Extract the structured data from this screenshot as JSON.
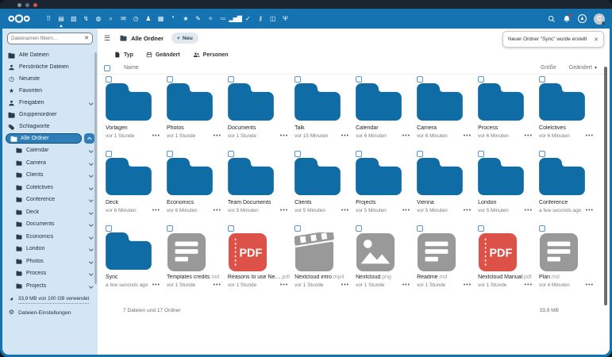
{
  "window": {
    "title_dots": [
      "gray",
      "slate",
      "red"
    ]
  },
  "topbar": {
    "logo_name": "nextcloud-logo",
    "apps": [
      {
        "name": "dashboard",
        "glyph": "⠿"
      },
      {
        "name": "files",
        "glyph": "▤",
        "active": true
      },
      {
        "name": "photos",
        "glyph": "▧"
      },
      {
        "name": "activity",
        "glyph": "↯"
      },
      {
        "name": "talk",
        "glyph": "◍"
      },
      {
        "name": "search-app",
        "glyph": "⌕"
      },
      {
        "name": "mail",
        "glyph": "✉"
      },
      {
        "name": "recent",
        "glyph": "◷"
      },
      {
        "name": "contacts",
        "glyph": "♟"
      },
      {
        "name": "calendar",
        "glyph": "▦"
      },
      {
        "name": "collectives",
        "glyph": "❜"
      },
      {
        "name": "favorites",
        "glyph": "★"
      },
      {
        "name": "notes",
        "glyph": "✎"
      },
      {
        "name": "recommendations",
        "glyph": "✧"
      },
      {
        "name": "tasks",
        "glyph": "≔"
      },
      {
        "name": "analytics",
        "glyph": "▂▅▇"
      },
      {
        "name": "approvals",
        "glyph": "✓"
      },
      {
        "name": "passwords",
        "glyph": "⚷"
      },
      {
        "name": "deck",
        "glyph": "◫"
      },
      {
        "name": "cookbook",
        "glyph": "Ψ"
      }
    ],
    "avatar_letter": "C"
  },
  "sidebar": {
    "filter": {
      "placeholder": "Dateinamen filtern...",
      "clear": "✕"
    },
    "items": [
      {
        "label": "Alle Dateien"
      },
      {
        "label": "Persönliche Dateien"
      },
      {
        "label": "Neueste"
      },
      {
        "label": "Favoriten"
      },
      {
        "label": "Freigaben"
      },
      {
        "label": "Gruppenordner"
      },
      {
        "label": "Schlagworte"
      }
    ],
    "selected_item": "Alle Ordner",
    "tree": [
      "Calendar",
      "Camera",
      "Clients",
      "Colelctives",
      "Conference",
      "Deck",
      "Documents",
      "Economics",
      "London",
      "Photos",
      "Process",
      "Projects"
    ],
    "quota": "33,9 MB von 100 GB verwendet",
    "settings": "Dateien-Einstellungen"
  },
  "main": {
    "breadcrumb": "Alle Ordner",
    "new_button": {
      "plus": "+",
      "label": "Neu"
    },
    "chips": [
      {
        "label": "Typ"
      },
      {
        "label": "Geändert"
      },
      {
        "label": "Personen"
      }
    ],
    "toast": {
      "text": "Neuer Ordner \"Sync\" wurde erstellt",
      "close": "✕"
    },
    "table": {
      "name": "Name",
      "size": "Größe",
      "modified": "Geändert",
      "sort": "▾"
    },
    "tiles": [
      {
        "name": "Vorlagen",
        "ext": "",
        "type": "folder",
        "date": "vor 1 Stunde"
      },
      {
        "name": "Photos",
        "ext": "",
        "type": "folder",
        "date": "vor 1 Stunde"
      },
      {
        "name": "Documents",
        "ext": "",
        "type": "folder",
        "date": "vor 1 Stunde"
      },
      {
        "name": "Talk",
        "ext": "",
        "type": "folder",
        "date": "vor 15 Minuten"
      },
      {
        "name": "Calendar",
        "ext": "",
        "type": "folder",
        "date": "vor 6 Minuten"
      },
      {
        "name": "Camera",
        "ext": "",
        "type": "folder",
        "date": "vor 6 Minuten"
      },
      {
        "name": "Process",
        "ext": "",
        "type": "folder",
        "date": "vor 6 Minuten"
      },
      {
        "name": "Colelctives",
        "ext": "",
        "type": "folder",
        "date": "vor 6 Minuten"
      },
      {
        "name": "Deck",
        "ext": "",
        "type": "folder",
        "date": "vor 6 Minuten"
      },
      {
        "name": "Economics",
        "ext": "",
        "type": "folder",
        "date": "vor 6 Minuten"
      },
      {
        "name": "Team Documents",
        "ext": "",
        "type": "folder",
        "date": "vor 5 Minuten"
      },
      {
        "name": "Clients",
        "ext": "",
        "type": "folder",
        "date": "vor 5 Minuten"
      },
      {
        "name": "Projects",
        "ext": "",
        "type": "folder",
        "date": "vor 5 Minuten"
      },
      {
        "name": "Vienna",
        "ext": "",
        "type": "folder",
        "date": "vor 5 Minuten"
      },
      {
        "name": "London",
        "ext": "",
        "type": "folder",
        "date": "vor 5 Minuten"
      },
      {
        "name": "Conference",
        "ext": "",
        "type": "folder",
        "date": "a few seconds ago"
      },
      {
        "name": "Sync",
        "ext": "",
        "type": "folder",
        "date": "a few seconds ago"
      },
      {
        "name": "Templates credits",
        "ext": ".md",
        "type": "doc",
        "date": "vor 1 Stunde"
      },
      {
        "name": "Reasons to use Ne…",
        "ext": ".pdf",
        "type": "pdf",
        "date": "vor 1 Stunde"
      },
      {
        "name": "Nextcloud intro",
        "ext": ".mp4",
        "type": "video",
        "date": "vor 1 Stunde"
      },
      {
        "name": "Nextcloud",
        "ext": ".png",
        "type": "image",
        "date": "vor 1 Stunde"
      },
      {
        "name": "Readme",
        "ext": ".md",
        "type": "doc",
        "date": "vor 1 Stunde"
      },
      {
        "name": "Nextcloud Manual",
        "ext": ".pdf",
        "type": "pdf",
        "date": "vor 1 Stunde"
      },
      {
        "name": "Plan",
        "ext": ".md",
        "type": "doc",
        "date": "vor 4 Minuten"
      }
    ],
    "footer": {
      "summary": "7 Dateien und 17 Ordner",
      "total_size": "33,9 MB"
    }
  },
  "colors": {
    "header_blue": "#1673b1",
    "folder_blue": "#0f6ca5",
    "pdf_red": "#dd5248",
    "file_gray": "#999999",
    "sidebar_bg": "#d4e6f3",
    "selected_pill": "#2e7fb8",
    "titlebar": "#1b2532",
    "notification_red": "#e9322d"
  },
  "pdf_label": "PDF"
}
